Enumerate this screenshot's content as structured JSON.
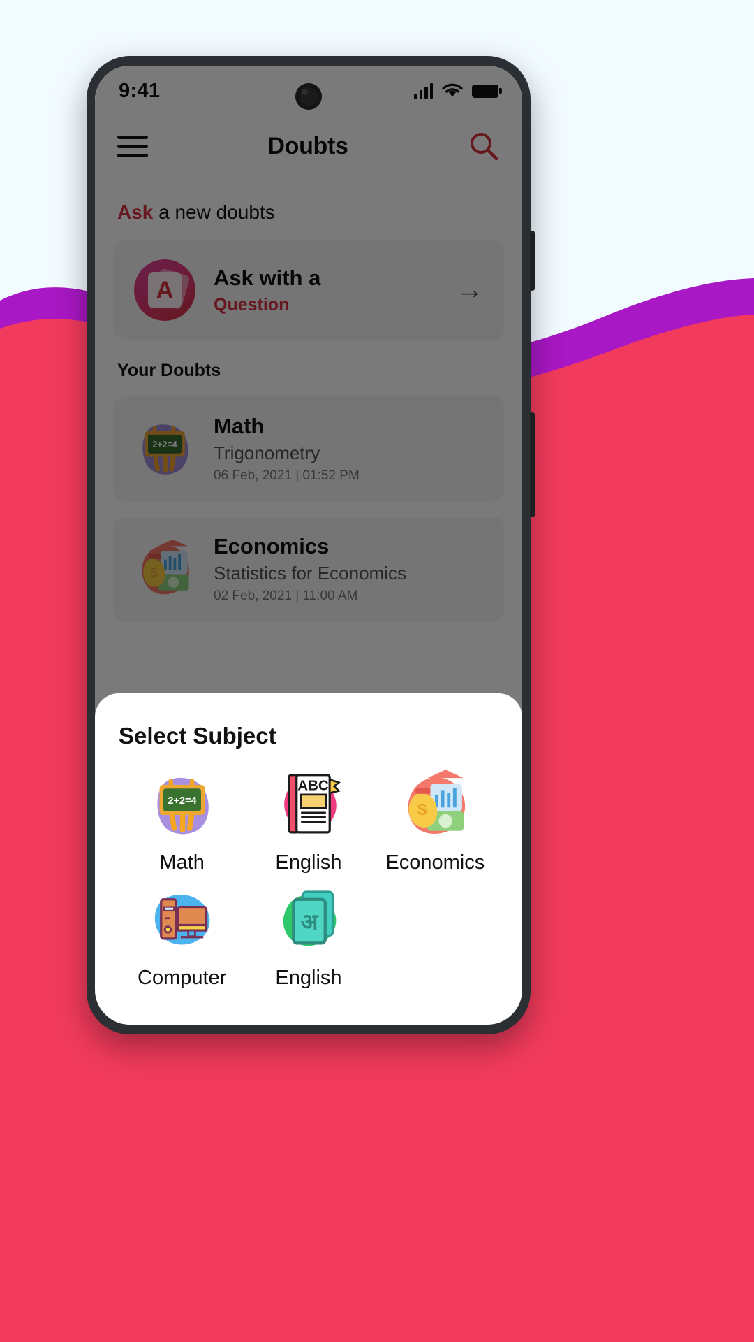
{
  "status_bar": {
    "time": "9:41",
    "signal_icon": "signal-bars-icon",
    "wifi_icon": "wifi-icon",
    "battery_icon": "battery-full-icon"
  },
  "app_bar": {
    "menu_icon": "hamburger-menu-icon",
    "title": "Doubts",
    "search_icon": "search-icon"
  },
  "ask_section": {
    "heading_accent": "Ask",
    "heading_rest": " a new doubts",
    "card": {
      "icon": "question-card-icon",
      "icon_letter": "A",
      "title": "Ask with a",
      "subtitle": "Question",
      "arrow_icon": "arrow-right-icon"
    }
  },
  "your_doubts": {
    "heading": "Your Doubts",
    "items": [
      {
        "icon": "blackboard-icon",
        "icon_text": "2+2=4",
        "subject": "Math",
        "topic": "Trigonometry",
        "timestamp": "06 Feb, 2021 | 01:52 PM"
      },
      {
        "icon": "economics-icon",
        "subject": "Economics",
        "topic": "Statistics for Economics",
        "timestamp": "02 Feb, 2021 | 11:00 AM"
      }
    ]
  },
  "bottom_sheet": {
    "title": "Select Subject",
    "subjects": [
      {
        "name": "Math",
        "icon": "blackboard-icon",
        "icon_text": "2+2=4"
      },
      {
        "name": "English",
        "icon": "abc-book-icon",
        "icon_text": "ABC"
      },
      {
        "name": "Economics",
        "icon": "economics-icon"
      },
      {
        "name": "Computer",
        "icon": "desktop-computer-icon"
      },
      {
        "name": "English",
        "icon": "hindi-cards-icon",
        "icon_text": "अ"
      }
    ]
  },
  "colors": {
    "accent_red": "#d6333f",
    "page_background": "#f2fbff",
    "wave_pink": "#f23b5c",
    "wave_purple": "#a818c4",
    "sheet_background": "#ffffff",
    "card_background": "#f4f4f6",
    "phone_frame": "#2b2f33"
  }
}
